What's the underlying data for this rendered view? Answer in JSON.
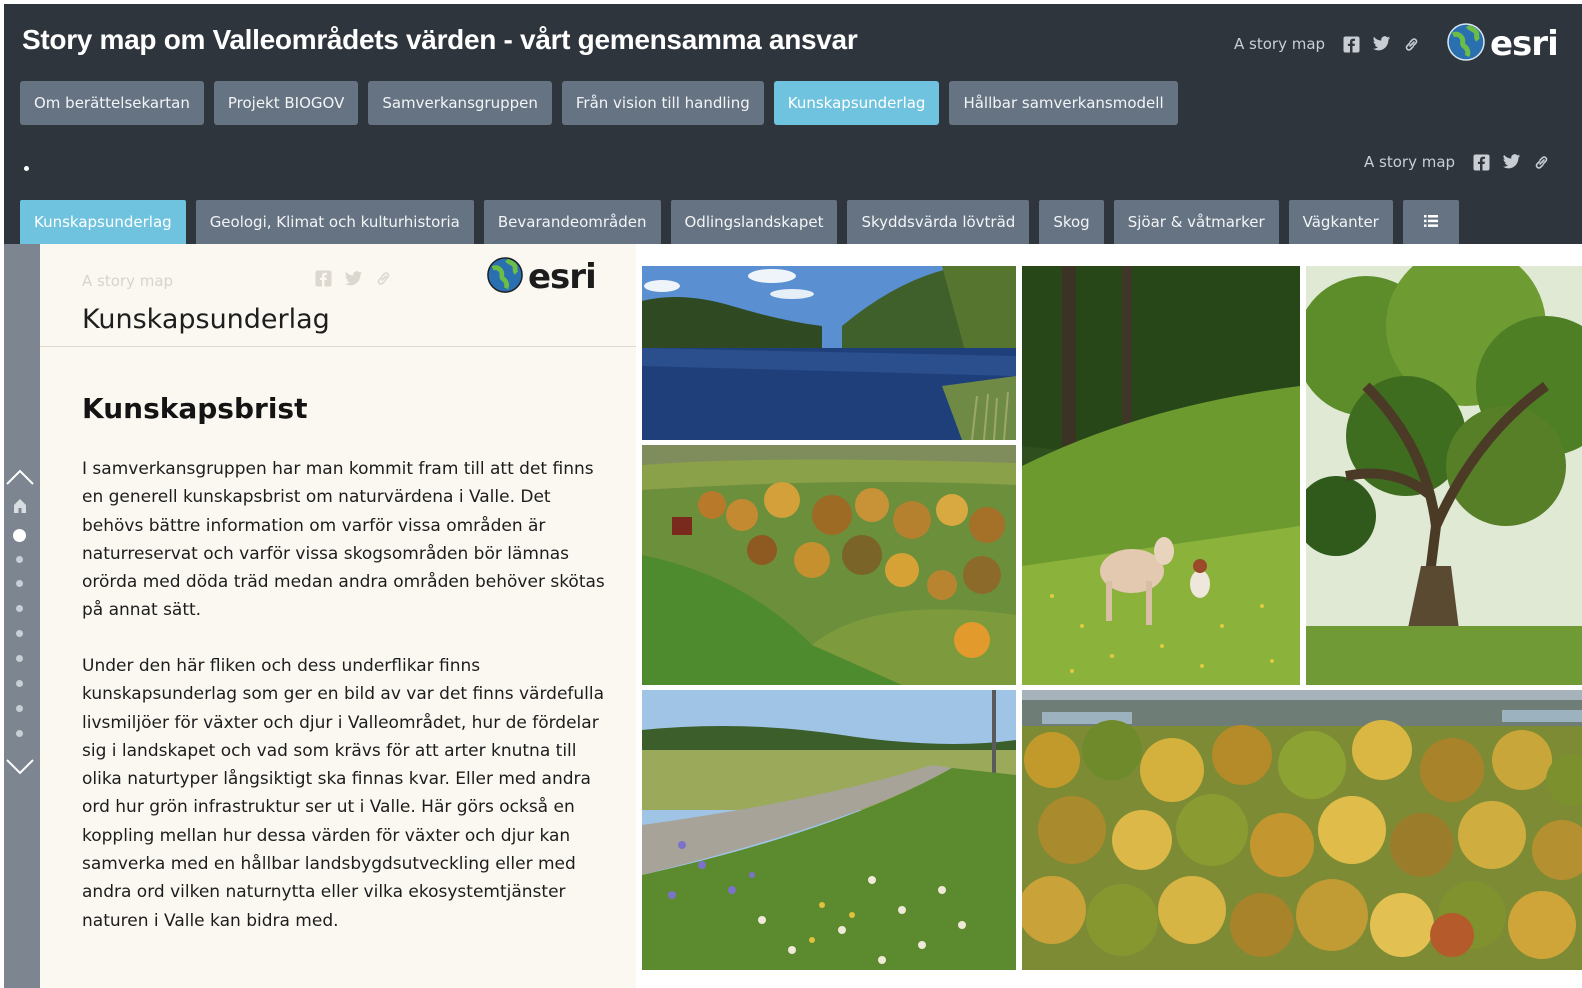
{
  "header": {
    "title": "Story map om Valleområdets värden - vårt gemensamma ansvar",
    "story_label": "A story map",
    "brand": "esri"
  },
  "top_tabs": [
    {
      "label": "Om berättelsekartan",
      "active": false
    },
    {
      "label": "Projekt BIOGOV",
      "active": false
    },
    {
      "label": "Samverkansgruppen",
      "active": false
    },
    {
      "label": "Från vision till handling",
      "active": false
    },
    {
      "label": "Kunskapsunderlag",
      "active": true
    },
    {
      "label": "Hållbar samverkansmodell",
      "active": false
    }
  ],
  "sub_header": {
    "story_label": "A story map"
  },
  "sub_tabs": [
    {
      "label": "Kunskapsunderlag",
      "active": true
    },
    {
      "label": "Geologi, Klimat och kulturhistoria",
      "active": false
    },
    {
      "label": "Bevarandeområden",
      "active": false
    },
    {
      "label": "Odlingslandskapet",
      "active": false
    },
    {
      "label": "Skyddsvärda lövträd",
      "active": false
    },
    {
      "label": "Skog",
      "active": false
    },
    {
      "label": "Sjöar & våtmarker",
      "active": false
    },
    {
      "label": "Vägkanter",
      "active": false
    }
  ],
  "panel": {
    "story_label": "A story map",
    "brand": "esri",
    "title": "Kunskapsunderlag",
    "heading": "Kunskapsbrist",
    "paragraphs": [
      "I samverkansgruppen har man kommit fram till att det finns en generell kunskapsbrist om naturvärdena i Valle. Det behövs bättre information om varför vissa områden är naturreservat och varför vissa skogsområden bör lämnas orörda med döda träd medan andra områden behöver skötas på annat sätt.",
      "Under den här fliken och dess underflikar finns kunskapsunderlag som ger en bild av var det finns värdefulla livsmiljöer för växter och djur i Valleområdet, hur de fördelar sig i landskapet och vad som krävs för att arter knutna till olika naturtyper långsiktigt ska finnas kvar. Eller med andra ord hur grön infrastruktur ser ut i Valle. Här görs också en koppling mellan hur dessa värden för växter och djur kan samverka med en hållbar landsbygdsutveckling eller med andra ord vilken naturnytta eller vilka ekosystemtjänster naturen i Valle kan bidra med."
    ]
  },
  "nav": {
    "dot_count": 9,
    "current_index": 0
  },
  "icons": {
    "facebook": "facebook-icon",
    "twitter": "twitter-icon",
    "link": "link-icon",
    "menu": "hamburger-menu-icon",
    "home": "home-icon",
    "up": "chevron-up-icon",
    "down": "chevron-down-icon",
    "globe": "esri-globe-icon"
  },
  "colors": {
    "header_bg": "#2f353d",
    "tab_bg": "#657382",
    "tab_active": "#6fc3de",
    "panel_bg": "#fbf8f1",
    "nav_strip": "#7c8590"
  }
}
